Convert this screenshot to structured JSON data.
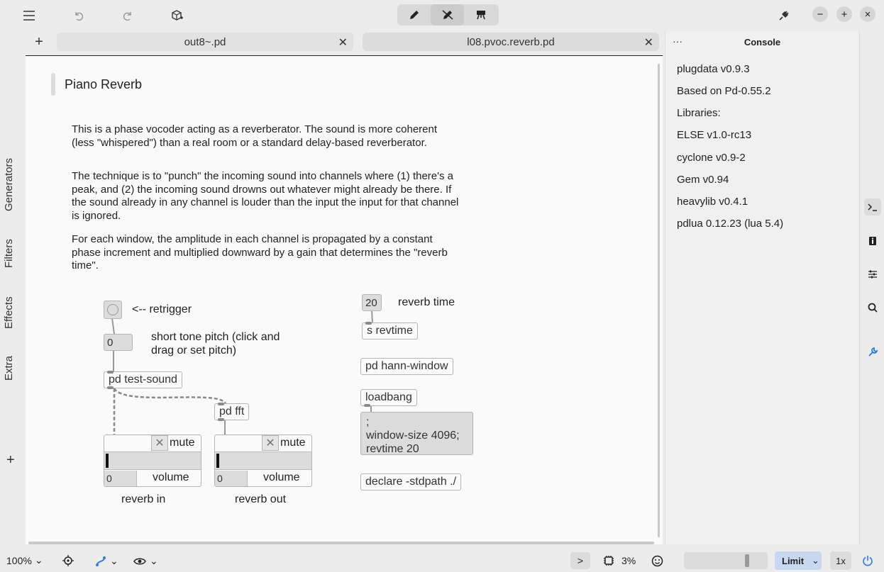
{
  "tabs": [
    {
      "label": "out8~.pd"
    },
    {
      "label": "l08.pvoc.reverb.pd"
    }
  ],
  "sidebar": {
    "items": [
      "Generators",
      "Filters",
      "Effects",
      "Extra"
    ]
  },
  "patch": {
    "title": "Piano Reverb",
    "comments": [
      "This is a phase vocoder acting as a reverberator. The sound is more coherent\n(less \"whispered\") than a real room or a standard delay-based reverberator.",
      "The technique is to \"punch\" the incoming sound into channels where (1) there's a\npeak, and (2) the incoming sound drowns out whatever might already be there. If\nthe sound already in any channel is louder than the input the input for that channel\nis ignored.",
      "For each window, the amplitude in each channel is propagated by a constant\nphase increment and multiplied downward by a gain that determines the \"reverb\ntime\"."
    ],
    "retrigger_label": "<-- retrigger",
    "pitch_value": "0",
    "pitch_label": "short tone pitch (click and\ndrag or set pitch)",
    "test_sound": "pd test-sound",
    "fft": "pd fft",
    "gain_in": {
      "mute": "mute",
      "volume": "volume",
      "value": "0",
      "label": "reverb in"
    },
    "gain_out": {
      "mute": "mute",
      "volume": "volume",
      "value": "0",
      "label": "reverb out"
    },
    "reverb_time_value": "20",
    "reverb_time_label": "reverb time",
    "revtime_send": "s revtime",
    "hann_window": "pd hann-window",
    "loadbang": "loadbang",
    "message": ";\nwindow-size 4096;\nrevtime 20",
    "declare": "declare -stdpath ./"
  },
  "console": {
    "title": "Console",
    "lines": [
      "plugdata v0.9.3",
      "Based on Pd-0.55.2",
      "Libraries:",
      "ELSE v1.0-rc13",
      "cyclone v0.9-2",
      "Gem v0.94",
      "heavylib v0.4.1",
      "pdlua 0.12.23 (lua 5.4)"
    ]
  },
  "status": {
    "zoom": "100%",
    "cpu": "3%",
    "limit": "Limit",
    "speed": "1x",
    "prompt": ">"
  }
}
